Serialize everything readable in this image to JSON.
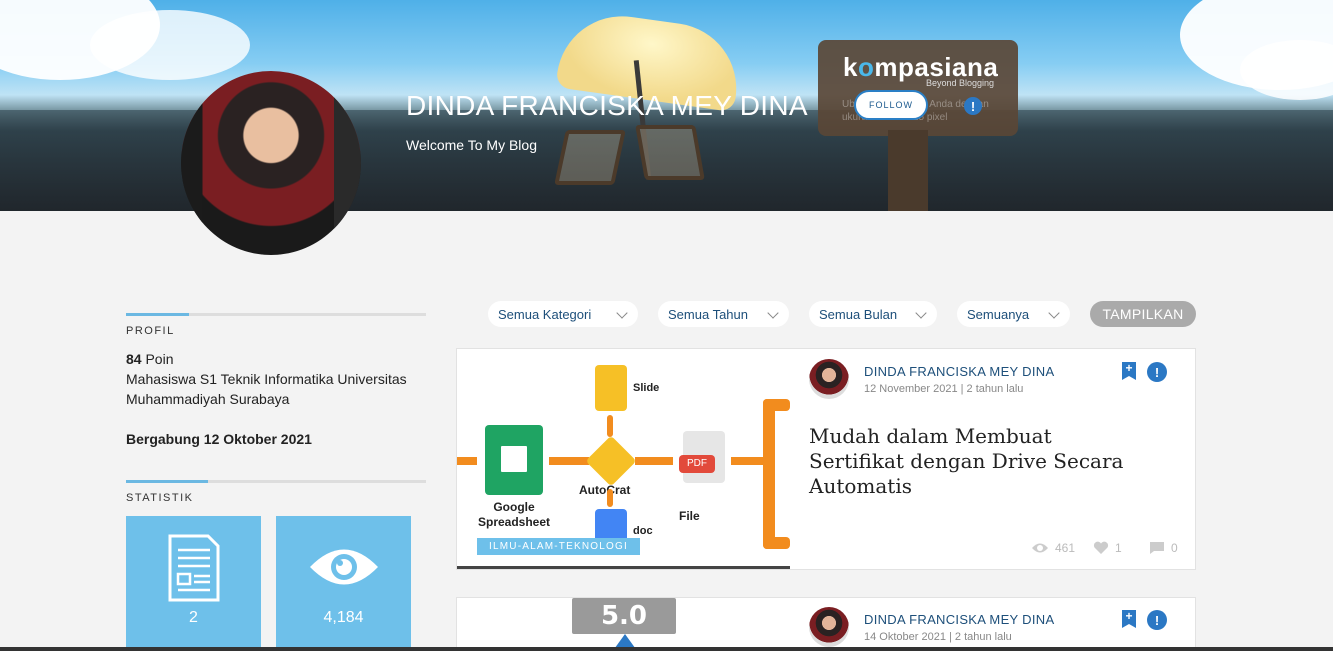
{
  "banner": {
    "logo_pre": "k",
    "logo_o": "o",
    "logo_post": "mpasiana",
    "logo_tagline": "Beyond Blogging",
    "note": "Ubah gambar profil Anda dengan ukuran 1100 x 225 pixel"
  },
  "profile": {
    "name": "DINDA FRANCISKA MEY DINA",
    "tagline": "Welcome To My Blog",
    "follow_label": "FOLLOW"
  },
  "sidebar": {
    "profil_heading": "PROFIL",
    "points_value": "84",
    "points_label": " Poin",
    "bio": "Mahasiswa S1 Teknik Informatika Universitas Muhammadiyah Surabaya",
    "joined": "Bergabung 12 Oktober 2021",
    "statistik_heading": "STATISTIK",
    "stats": [
      {
        "icon": "document-icon",
        "value": "2"
      },
      {
        "icon": "eye-icon",
        "value": "4,184"
      }
    ]
  },
  "filters": {
    "category": "Semua Kategori",
    "year": "Semua Tahun",
    "month": "Semua Bulan",
    "type": "Semuanya",
    "submit": "TAMPILKAN"
  },
  "posts": [
    {
      "author": "DINDA FRANCISKA MEY DINA",
      "date": "12 November 2021 | 2 tahun lalu",
      "title": "Mudah dalam Membuat Sertifikat dengan Drive Secara Automatis",
      "category": "ILMU-ALAM-TEKNOLOGI",
      "views": "461",
      "likes": "1",
      "comments": "0",
      "thumb": {
        "slide": "Slide",
        "sheet": "Google Spreadsheet",
        "autocrat": "AutoCrat",
        "doc": "doc",
        "file": "File",
        "pdf": "PDF"
      }
    },
    {
      "author": "DINDA FRANCISKA MEY DINA",
      "date": "14 Oktober 2021 | 2 tahun lalu",
      "thumb_badge": "5.0"
    }
  ],
  "colors": {
    "accent": "#6ec0ea",
    "link": "#1d4f7a",
    "icon_blue": "#2b78c4"
  }
}
